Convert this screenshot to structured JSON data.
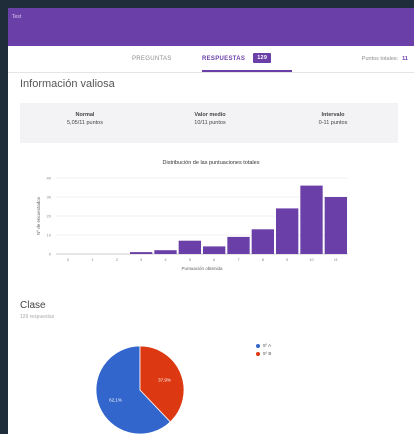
{
  "header": {
    "doc_label": "Test"
  },
  "tabs": [
    {
      "label": "PREGUNTAS"
    },
    {
      "label": "RESPUESTAS",
      "count": "129"
    }
  ],
  "totals": {
    "label": "Puntos totales:",
    "value": "11"
  },
  "insights": {
    "title": "Información valiosa",
    "stats": [
      {
        "label": "Normal",
        "value": "5,05/11 puntos"
      },
      {
        "label": "Valor medio",
        "value": "10/11 puntos"
      },
      {
        "label": "Intervalo",
        "value": "0-11 puntos"
      }
    ]
  },
  "chart_data": {
    "type": "bar",
    "title": "Distribución de las puntuaciones totales",
    "xlabel": "Puntuación obtenida",
    "ylabel": "Nº de encuestados",
    "categories": [
      "0",
      "1",
      "2",
      "3",
      "4",
      "5",
      "6",
      "7",
      "8",
      "9",
      "10",
      "11"
    ],
    "values": [
      0,
      0,
      0,
      1,
      2,
      7,
      4,
      9,
      13,
      24,
      36,
      30
    ],
    "yticks": [
      0,
      10,
      20,
      30,
      40
    ],
    "ylim": [
      0,
      40
    ],
    "color": "#6b3fa8"
  },
  "question": {
    "title": "Clase",
    "subtitle": "129 respuestas",
    "pie": {
      "type": "pie",
      "slices": [
        {
          "label": "5º A",
          "value": 62.1,
          "display": "62,1%",
          "color": "#3366cc"
        },
        {
          "label": "5º B",
          "value": 37.9,
          "display": "37,9%",
          "color": "#dc3912"
        }
      ]
    }
  }
}
